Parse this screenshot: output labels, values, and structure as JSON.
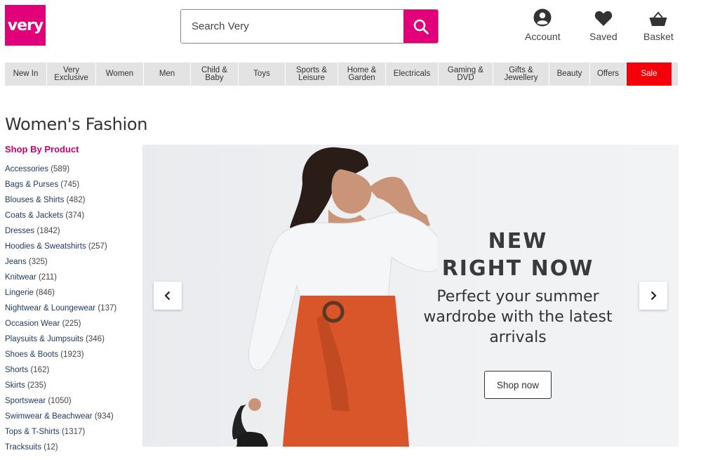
{
  "header": {
    "logo_text": "very",
    "search_placeholder": "Search Very",
    "links": [
      {
        "label": "Account",
        "icon": "account-icon"
      },
      {
        "label": "Saved",
        "icon": "heart-icon"
      },
      {
        "label": "Basket",
        "icon": "basket-icon"
      }
    ]
  },
  "nav": {
    "items": [
      "New In",
      "Very Exclusive",
      "Women",
      "Men",
      "Child & Baby",
      "Toys",
      "Sports & Leisure",
      "Home & Garden",
      "Electricals",
      "Gaming & DVD",
      "Gifts & Jewellery",
      "Beauty",
      "Offers",
      "Sale"
    ]
  },
  "page": {
    "title": "Women's Fashion"
  },
  "sidebar": {
    "heading": "Shop By Product",
    "categories": [
      {
        "name": "Accessories",
        "count": "(589)"
      },
      {
        "name": "Bags & Purses",
        "count": "(745)"
      },
      {
        "name": "Blouses & Shirts",
        "count": "(482)"
      },
      {
        "name": "Coats & Jackets",
        "count": "(374)"
      },
      {
        "name": "Dresses",
        "count": "(1842)"
      },
      {
        "name": "Hoodies & Sweatshirts",
        "count": "(257)"
      },
      {
        "name": "Jeans",
        "count": "(325)"
      },
      {
        "name": "Knitwear",
        "count": "(211)"
      },
      {
        "name": "Lingerie",
        "count": "(846)"
      },
      {
        "name": "Nightwear & Loungewear",
        "count": "(137)"
      },
      {
        "name": "Occasion Wear",
        "count": "(225)"
      },
      {
        "name": "Playsuits & Jumpsuits",
        "count": "(346)"
      },
      {
        "name": "Shoes & Boots",
        "count": "(1923)"
      },
      {
        "name": "Shorts",
        "count": "(162)"
      },
      {
        "name": "Skirts",
        "count": "(235)"
      },
      {
        "name": "Sportswear",
        "count": "(1050)"
      },
      {
        "name": "Swimwear & Beachwear",
        "count": "(934)"
      },
      {
        "name": "Tops & T-Shirts",
        "count": "(1317)"
      },
      {
        "name": "Tracksuits",
        "count": "(12)"
      }
    ]
  },
  "hero": {
    "headline_1": "NEW",
    "headline_2": "RIGHT NOW",
    "subtext": "Perfect your summer wardrobe with the latest arrivals",
    "cta": "Shop now"
  },
  "colors": {
    "brand": "#e2007a",
    "sale": "#f5000a",
    "nav_bg": "#e3e3e3"
  }
}
